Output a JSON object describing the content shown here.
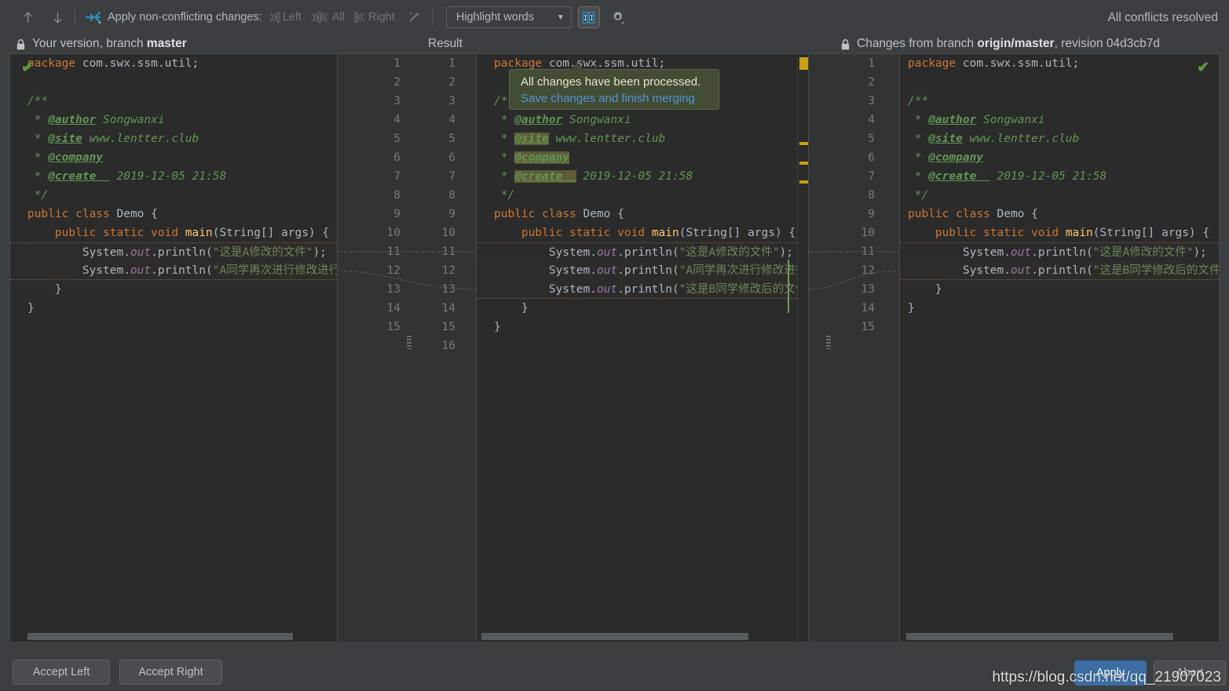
{
  "toolbar": {
    "prev_label": "previous-difference",
    "next_label": "next-difference",
    "apply_all_label": "apply-all",
    "apply_text": "Apply non-conflicting changes:",
    "actions": [
      {
        "name": "left",
        "label": "Left"
      },
      {
        "name": "all",
        "label": "All"
      },
      {
        "name": "right",
        "label": "Right"
      }
    ],
    "magic_label": "magic-resolve",
    "highlight_mode": "Highlight words",
    "highlight_caret": "▼",
    "collapse_toggle_label": "collapse-unchanged-fragments",
    "settings_label": "settings",
    "status": "All conflicts resolved"
  },
  "panes": {
    "left": {
      "title_prefix": "Your version, branch ",
      "title_bold": "master",
      "title_suffix": "",
      "lock": true,
      "check": true
    },
    "mid": {
      "title_prefix": "Result",
      "title_bold": "",
      "title_suffix": "",
      "lock": false,
      "check": false
    },
    "right": {
      "title_prefix": "Changes from branch ",
      "title_bold": "origin/master",
      "title_suffix": ", revision 04d3cb7d",
      "lock": true,
      "check": true
    }
  },
  "tooltip": {
    "line1": "All changes have been processed.",
    "line2": "Save changes and finish merging"
  },
  "gutters": {
    "left_numbers_a": [
      "1",
      "2",
      "3",
      "4",
      "5",
      "6",
      "7",
      "8",
      "9",
      "10",
      "11",
      "12",
      "13",
      "14",
      "15"
    ],
    "left_numbers_b": [
      "1",
      "2",
      "3",
      "4",
      "5",
      "6",
      "7",
      "8",
      "9",
      "10",
      "11",
      "12",
      "13",
      "14",
      "15",
      "16"
    ],
    "right_numbers": [
      "1",
      "2",
      "3",
      "4",
      "5",
      "6",
      "7",
      "8",
      "9",
      "10",
      "11",
      "12",
      "13",
      "14",
      "15"
    ]
  },
  "code": {
    "left": [
      [
        {
          "t": "kw",
          "v": "package"
        },
        {
          "t": "id",
          "v": " com.swx.ssm.util"
        },
        {
          "t": "punc",
          "v": ";"
        }
      ],
      [],
      [
        {
          "t": "cmt",
          "v": "/**"
        }
      ],
      [
        {
          "t": "cmt",
          "v": " * "
        },
        {
          "t": "tag",
          "v": "@author"
        },
        {
          "t": "cmt",
          "v": " Songwanxi"
        }
      ],
      [
        {
          "t": "cmt",
          "v": " * "
        },
        {
          "t": "tag",
          "v": "@site"
        },
        {
          "t": "cmt",
          "v": " www.lentter.club"
        }
      ],
      [
        {
          "t": "cmt",
          "v": " * "
        },
        {
          "t": "tag",
          "v": "@company"
        }
      ],
      [
        {
          "t": "cmt",
          "v": " * "
        },
        {
          "t": "tag",
          "v": "@create  "
        },
        {
          "t": "cmt",
          "v": " 2019-12-05 21:58"
        }
      ],
      [
        {
          "t": "cmt",
          "v": " */"
        }
      ],
      [
        {
          "t": "kw",
          "v": "public class"
        },
        {
          "t": "id",
          "v": " Demo {"
        }
      ],
      [
        {
          "t": "id",
          "v": "    "
        },
        {
          "t": "kw",
          "v": "public static void"
        },
        {
          "t": "mth",
          "v": " main"
        },
        {
          "t": "id",
          "v": "(String[] args) {"
        }
      ],
      [
        {
          "t": "id",
          "v": "        System."
        },
        {
          "t": "fld",
          "v": "out"
        },
        {
          "t": "id",
          "v": ".println("
        },
        {
          "t": "str",
          "v": "\"这是A修改的文件\""
        },
        {
          "t": "punc",
          "v": ");"
        }
      ],
      [
        {
          "t": "id",
          "v": "        System."
        },
        {
          "t": "fld",
          "v": "out"
        },
        {
          "t": "id",
          "v": ".println("
        },
        {
          "t": "str",
          "v": "\"A同学再次进行修改进行"
        }
      ],
      [
        {
          "t": "id",
          "v": "    }"
        }
      ],
      [
        {
          "t": "id",
          "v": "}"
        }
      ]
    ],
    "mid": [
      [
        {
          "t": "kw",
          "v": "package"
        },
        {
          "t": "id",
          "v": " com.swx.ssm.util"
        },
        {
          "t": "punc",
          "v": ";"
        }
      ],
      [],
      [
        {
          "t": "cmt",
          "v": "/**"
        }
      ],
      [
        {
          "t": "cmt",
          "v": " * "
        },
        {
          "t": "tag",
          "v": "@author"
        },
        {
          "t": "cmt",
          "v": " Songwanxi"
        }
      ],
      [
        {
          "t": "cmt",
          "v": " * "
        },
        {
          "t": "tag hl",
          "v": "@site"
        },
        {
          "t": "cmt",
          "v": " www.lentter.club"
        }
      ],
      [
        {
          "t": "cmt",
          "v": " * "
        },
        {
          "t": "tag hl",
          "v": "@company"
        }
      ],
      [
        {
          "t": "cmt",
          "v": " * "
        },
        {
          "t": "tag hl",
          "v": "@create  "
        },
        {
          "t": "cmt",
          "v": " 2019-12-05 21:58"
        }
      ],
      [
        {
          "t": "cmt",
          "v": " */"
        }
      ],
      [
        {
          "t": "kw",
          "v": "public class"
        },
        {
          "t": "id",
          "v": " Demo {"
        }
      ],
      [
        {
          "t": "id",
          "v": "    "
        },
        {
          "t": "kw",
          "v": "public static void"
        },
        {
          "t": "mth",
          "v": " main"
        },
        {
          "t": "id",
          "v": "(String[] args) {"
        }
      ],
      [
        {
          "t": "id",
          "v": "        System."
        },
        {
          "t": "fld",
          "v": "out"
        },
        {
          "t": "id",
          "v": ".println("
        },
        {
          "t": "str",
          "v": "\"这是A修改的文件\""
        },
        {
          "t": "punc",
          "v": ");"
        }
      ],
      [
        {
          "t": "id",
          "v": "        System."
        },
        {
          "t": "fld",
          "v": "out"
        },
        {
          "t": "id",
          "v": ".println("
        },
        {
          "t": "str",
          "v": "\"A同学再次进行修改进行提交"
        }
      ],
      [
        {
          "t": "id",
          "v": "        System."
        },
        {
          "t": "fld",
          "v": "out"
        },
        {
          "t": "id",
          "v": ".println("
        },
        {
          "t": "str",
          "v": "\"这是B同学修改后的文件\""
        },
        {
          "t": "punc",
          "v": ");"
        }
      ],
      [
        {
          "t": "id",
          "v": "    }"
        }
      ],
      [
        {
          "t": "id",
          "v": "}"
        }
      ]
    ],
    "right": [
      [
        {
          "t": "kw",
          "v": "package"
        },
        {
          "t": "id",
          "v": " com.swx.ssm.util"
        },
        {
          "t": "punc",
          "v": ";"
        }
      ],
      [],
      [
        {
          "t": "cmt",
          "v": "/**"
        }
      ],
      [
        {
          "t": "cmt",
          "v": " * "
        },
        {
          "t": "tag",
          "v": "@author"
        },
        {
          "t": "cmt",
          "v": " Songwanxi"
        }
      ],
      [
        {
          "t": "cmt",
          "v": " * "
        },
        {
          "t": "tag",
          "v": "@site"
        },
        {
          "t": "cmt",
          "v": " www.lentter.club"
        }
      ],
      [
        {
          "t": "cmt",
          "v": " * "
        },
        {
          "t": "tag",
          "v": "@company"
        }
      ],
      [
        {
          "t": "cmt",
          "v": " * "
        },
        {
          "t": "tag",
          "v": "@create  "
        },
        {
          "t": "cmt",
          "v": " 2019-12-05 21:58"
        }
      ],
      [
        {
          "t": "cmt",
          "v": " */"
        }
      ],
      [
        {
          "t": "kw",
          "v": "public class"
        },
        {
          "t": "id",
          "v": " Demo {"
        }
      ],
      [
        {
          "t": "id",
          "v": "    "
        },
        {
          "t": "kw",
          "v": "public static void"
        },
        {
          "t": "mth",
          "v": " main"
        },
        {
          "t": "id",
          "v": "(String[] args) {"
        }
      ],
      [
        {
          "t": "id",
          "v": "        System."
        },
        {
          "t": "fld",
          "v": "out"
        },
        {
          "t": "id",
          "v": ".println("
        },
        {
          "t": "str",
          "v": "\"这是A修改的文件\""
        },
        {
          "t": "punc",
          "v": ");"
        }
      ],
      [
        {
          "t": "id",
          "v": "        System."
        },
        {
          "t": "fld",
          "v": "out"
        },
        {
          "t": "id",
          "v": ".println("
        },
        {
          "t": "str",
          "v": "\"这是B同学修改后的文件\""
        },
        {
          "t": "punc",
          "v": ");"
        }
      ],
      [
        {
          "t": "id",
          "v": "    }"
        }
      ],
      [
        {
          "t": "id",
          "v": "}"
        }
      ]
    ]
  },
  "buttons": {
    "accept_left": "Accept Left",
    "accept_right": "Accept Right",
    "apply": "Apply",
    "abort": "Abort"
  },
  "watermark": "https://blog.csdn.net/qq_21907023",
  "colors": {
    "accent": "#3a6ea5",
    "ok": "#5a9c42",
    "stripe": "#c8a016",
    "accepted": "#3d5c33",
    "tooltip_bg": "#434c35",
    "link": "#4f97d6"
  }
}
